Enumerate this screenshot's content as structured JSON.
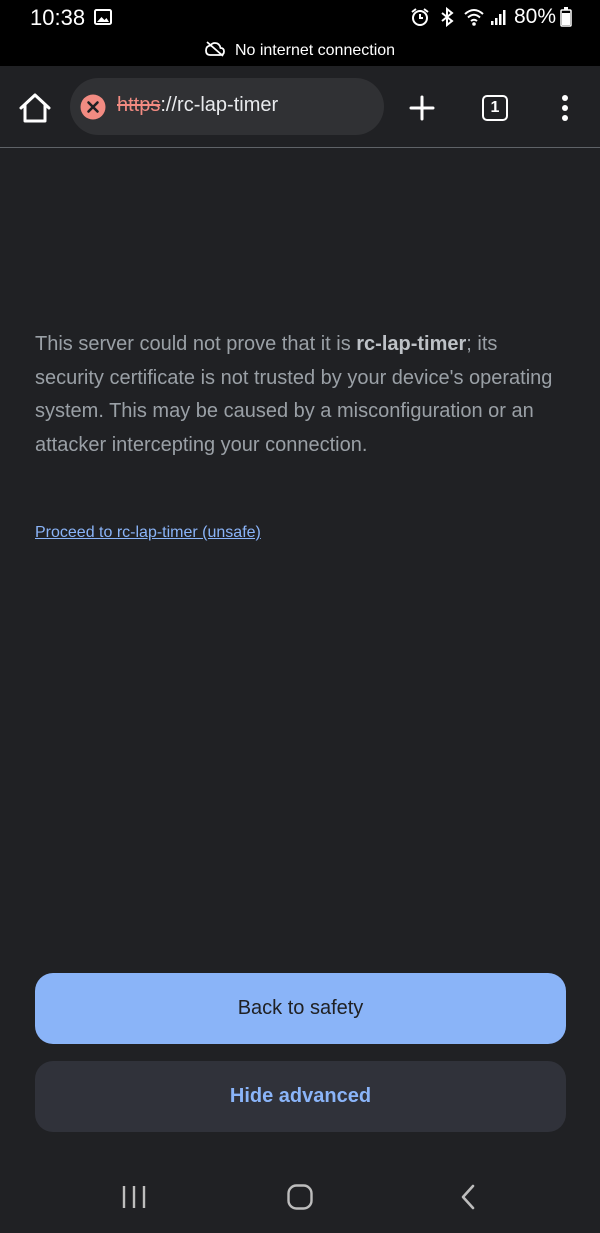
{
  "status_bar": {
    "time": "10:38",
    "battery": "80%"
  },
  "banner": {
    "text": "No internet connection"
  },
  "toolbar": {
    "url_scheme": "https",
    "url_rest": "://rc-lap-timer",
    "tab_count": "1"
  },
  "interstitial": {
    "message_before": "This server could not prove that it is ",
    "host": "rc-lap-timer",
    "message_after": "; its security certificate is not trusted by your device's operating system. This may be caused by a misconfiguration or an attacker intercepting your connection.",
    "proceed_link": "Proceed to rc-lap-timer (unsafe)",
    "back_button": "Back to safety",
    "hide_button": "Hide advanced"
  },
  "colors": {
    "background": "#202124",
    "primary_button": "#8ab4f8",
    "warning": "#f28b82"
  }
}
